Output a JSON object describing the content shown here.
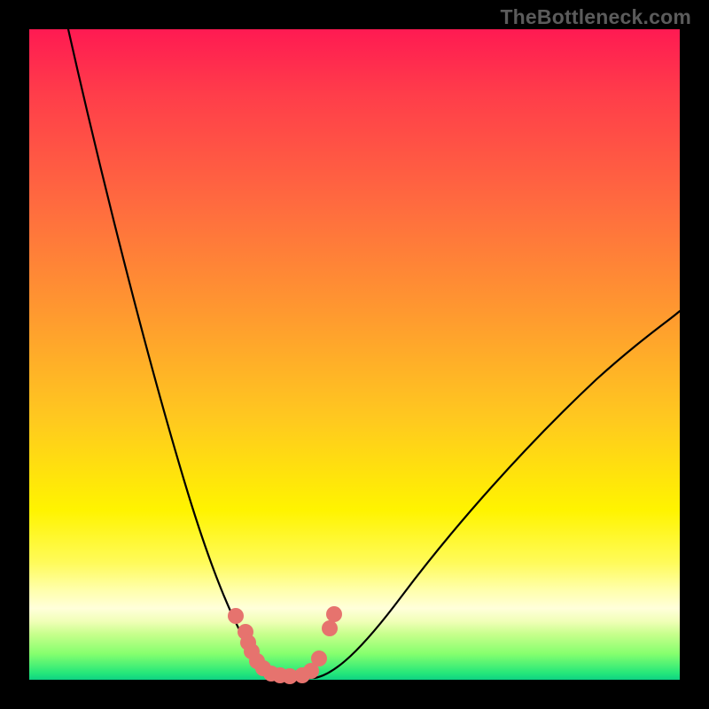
{
  "watermark": "TheBottleneck.com",
  "chart_data": {
    "type": "line",
    "title": "",
    "xlabel": "",
    "ylabel": "",
    "xlim": [
      0,
      100
    ],
    "ylim": [
      0,
      100
    ],
    "grid": false,
    "legend": false,
    "series": [
      {
        "name": "left-branch",
        "x": [
          6,
          10,
          14,
          18,
          22,
          26,
          30,
          32,
          34,
          36
        ],
        "values": [
          100,
          80,
          60,
          44,
          30,
          18,
          8,
          4,
          1,
          0
        ]
      },
      {
        "name": "valley-floor",
        "x": [
          36,
          40,
          44
        ],
        "values": [
          0,
          0,
          0
        ]
      },
      {
        "name": "right-branch",
        "x": [
          44,
          48,
          54,
          62,
          72,
          84,
          100
        ],
        "values": [
          0,
          3,
          9,
          18,
          30,
          43,
          58
        ]
      }
    ],
    "markers": {
      "name": "cluster-points",
      "color": "#e6736e",
      "x": [
        31.8,
        33.2,
        33.6,
        34.2,
        35.0,
        36.0,
        37.2,
        38.5,
        40.0,
        42.0,
        43.3,
        44.5,
        46.2,
        46.8
      ],
      "values": [
        10.0,
        7.5,
        6.0,
        4.5,
        3.0,
        1.8,
        1.0,
        0.6,
        0.5,
        0.8,
        1.5,
        3.4,
        8.0,
        10.2
      ]
    },
    "background_gradient": {
      "top": "#ff1a52",
      "mid": "#fff400",
      "bottom": "#0fd183"
    }
  }
}
